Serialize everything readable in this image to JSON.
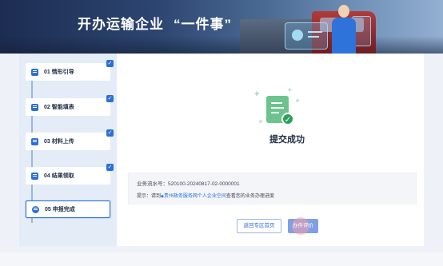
{
  "banner": {
    "title": "开办运输企业",
    "title_quoted": "“一件事”"
  },
  "steps": [
    {
      "label": "01  情形引导",
      "icon": "guide-icon",
      "completed": true
    },
    {
      "label": "02  智能填表",
      "icon": "form-icon",
      "completed": true
    },
    {
      "label": "03  材料上传",
      "icon": "upload-icon",
      "completed": true
    },
    {
      "label": "04  结果领取",
      "icon": "result-icon",
      "completed": true
    },
    {
      "label": "05  申报完成",
      "icon": "shield-icon",
      "completed": false,
      "active": true
    }
  ],
  "result": {
    "title": "提交成功",
    "serial_label": "业务流水号：",
    "serial_value": "520100-20240817-02-0000001",
    "tip_prefix": "提示：请到",
    "tip_link": "贵州政务服务网个人企业空间",
    "tip_suffix": "查看您的业务办理进度"
  },
  "buttons": {
    "return": "返回专区首页",
    "office": "办件评价"
  },
  "colors": {
    "accent": "#2c6fd8",
    "success": "#2aa35a",
    "sidebar_bg": "#e4ecf8"
  }
}
